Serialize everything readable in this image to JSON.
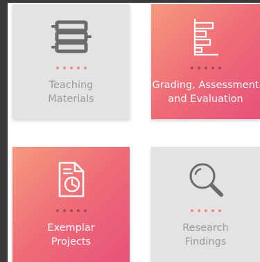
{
  "tiles": [
    {
      "id": "teaching-materials",
      "style": "grey",
      "icon": "books-stack-icon",
      "label_line1": "Teaching",
      "label_line2": "Materials"
    },
    {
      "id": "grading",
      "style": "pink",
      "icon": "bar-chart-document-icon",
      "label_line1": "Grading, Assessment",
      "label_line2": "and Evaluation"
    },
    {
      "id": "exemplar-projects",
      "style": "pink",
      "icon": "report-clock-document-icon",
      "label_line1": "Exemplar",
      "label_line2": "Projects"
    },
    {
      "id": "research-findings",
      "style": "grey",
      "icon": "magnifying-glass-icon",
      "label_line1": "Research",
      "label_line2": "Findings"
    }
  ],
  "colors": {
    "grey_tile": "#e3e3e3",
    "pink_start": "#f69a7f",
    "pink_end": "#e8517b",
    "grey_icon": "#6b6b6b",
    "grey_label": "#9a9a9a",
    "frame": "#3a3a3a"
  }
}
